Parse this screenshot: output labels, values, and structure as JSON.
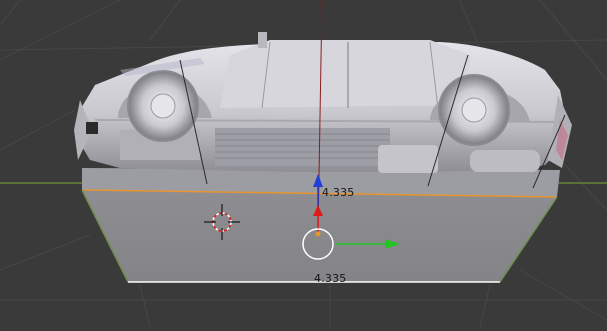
{
  "viewport": {
    "background_color": "#3a3a3a",
    "grid_color": "#4a4a4a",
    "x_axis_color": "#7fa63a",
    "y_axis_color": "#8b1d1d"
  },
  "measurements": {
    "top_edge_length": "4.335",
    "bottom_edge_length": "4.335"
  },
  "selection": {
    "active_edge_color": "#e6952f"
  },
  "gizmo": {
    "x_arrow_color": "#22c422",
    "y_arrow_color": "#1f3fd8",
    "z_arrow_color": "#e01a1a"
  },
  "icons": {
    "cursor": "3d-cursor-icon",
    "manipulator": "transform-gizmo-icon"
  }
}
